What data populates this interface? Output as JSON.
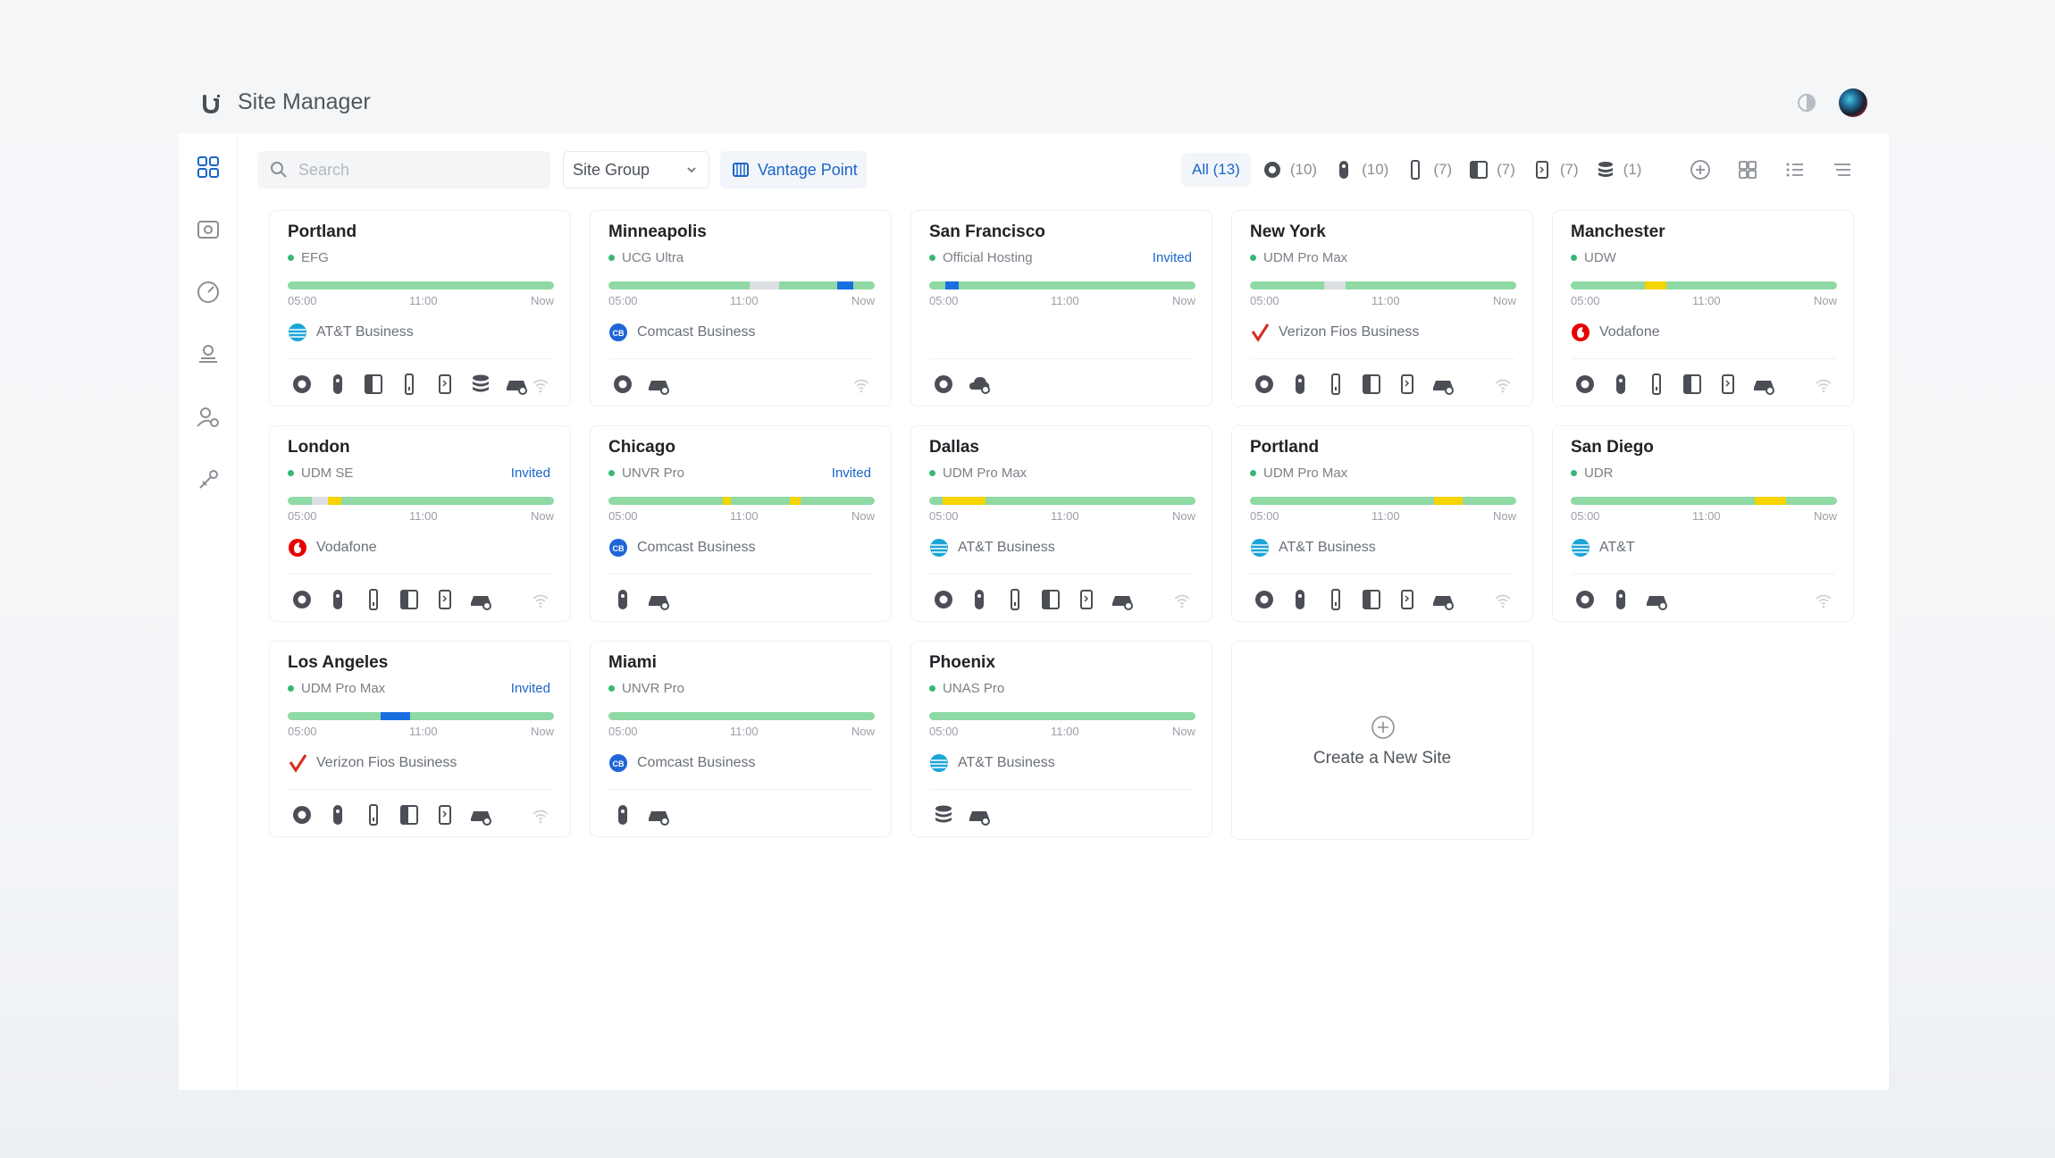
{
  "app": {
    "title": "Site Manager"
  },
  "toolbar": {
    "search_placeholder": "Search",
    "site_group_label": "Site Group",
    "vantage_point_label": "Vantage Point",
    "filters": [
      {
        "icon": "all",
        "label": "All (13)",
        "count": ""
      },
      {
        "icon": "console-icon",
        "label": "",
        "count": "(10)"
      },
      {
        "icon": "access-point-icon",
        "label": "",
        "count": "(10)"
      },
      {
        "icon": "tower-icon",
        "label": "",
        "count": "(7)"
      },
      {
        "icon": "switch-icon",
        "label": "",
        "count": "(7)"
      },
      {
        "icon": "doorbell-icon",
        "label": "",
        "count": "(7)"
      },
      {
        "icon": "storage-icon",
        "label": "",
        "count": "(1)"
      }
    ]
  },
  "colors": {
    "accent": "#1b66c9",
    "online": "#39b776",
    "bar_ok": "#8ed9a4",
    "bar_warn": "#f5d400",
    "bar_offline": "#dcdfe3",
    "bar_blue": "#1a6fe0"
  },
  "ticks": {
    "start": "05:00",
    "mid": "11:00",
    "end": "Now"
  },
  "sites": [
    {
      "name": "Portland",
      "device": "EFG",
      "invited": "",
      "isp": "AT&T Business",
      "isp_logo": "att",
      "segments": [],
      "devices": [
        "console",
        "access-point",
        "switch",
        "tower",
        "doorbell",
        "storage",
        "gateway"
      ],
      "wifi": true
    },
    {
      "name": "Minneapolis",
      "device": "UCG Ultra",
      "invited": "",
      "isp": "Comcast Business",
      "isp_logo": "comcast",
      "segments": [
        {
          "from": 0.53,
          "to": 0.64,
          "color": "offline"
        },
        {
          "from": 0.86,
          "to": 0.92,
          "color": "blue"
        }
      ],
      "devices": [
        "console",
        "gateway"
      ],
      "wifi": true
    },
    {
      "name": "San Francisco",
      "device": "Official Hosting",
      "invited": "Invited",
      "isp": "",
      "isp_logo": "",
      "segments": [
        {
          "from": 0.06,
          "to": 0.11,
          "color": "blue"
        }
      ],
      "devices": [
        "console",
        "cloud-gateway"
      ],
      "wifi": false
    },
    {
      "name": "New York",
      "device": "UDM Pro Max",
      "invited": "",
      "isp": "Verizon Fios Business",
      "isp_logo": "verizon",
      "segments": [
        {
          "from": 0.28,
          "to": 0.36,
          "color": "offline"
        }
      ],
      "devices": [
        "console",
        "access-point",
        "tower",
        "switch",
        "doorbell",
        "gateway"
      ],
      "wifi": true
    },
    {
      "name": "Manchester",
      "device": "UDW",
      "invited": "",
      "isp": "Vodafone",
      "isp_logo": "vodafone",
      "segments": [
        {
          "from": 0.28,
          "to": 0.36,
          "color": "warn"
        }
      ],
      "devices": [
        "console",
        "access-point",
        "tower",
        "switch",
        "doorbell",
        "gateway"
      ],
      "wifi": true
    },
    {
      "name": "London",
      "device": "UDM SE",
      "invited": "Invited",
      "isp": "Vodafone",
      "isp_logo": "vodafone",
      "segments": [
        {
          "from": 0.09,
          "to": 0.15,
          "color": "offline"
        },
        {
          "from": 0.15,
          "to": 0.2,
          "color": "warn"
        }
      ],
      "devices": [
        "console",
        "access-point",
        "tower",
        "switch",
        "doorbell",
        "gateway"
      ],
      "wifi": true
    },
    {
      "name": "Chicago",
      "device": "UNVR Pro",
      "invited": "Invited",
      "isp": "Comcast Business",
      "isp_logo": "comcast",
      "segments": [
        {
          "from": 0.43,
          "to": 0.46,
          "color": "warn"
        },
        {
          "from": 0.68,
          "to": 0.72,
          "color": "warn"
        }
      ],
      "devices": [
        "access-point",
        "gateway"
      ],
      "wifi": false
    },
    {
      "name": "Dallas",
      "device": "UDM Pro Max",
      "invited": "",
      "isp": "AT&T Business",
      "isp_logo": "att",
      "segments": [
        {
          "from": 0.05,
          "to": 0.21,
          "color": "warn"
        }
      ],
      "devices": [
        "console",
        "access-point",
        "tower",
        "switch",
        "doorbell",
        "gateway"
      ],
      "wifi": true
    },
    {
      "name": "Portland",
      "device": "UDM Pro Max",
      "invited": "",
      "isp": "AT&T Business",
      "isp_logo": "att",
      "segments": [
        {
          "from": 0.69,
          "to": 0.8,
          "color": "warn"
        }
      ],
      "devices": [
        "console",
        "access-point",
        "tower",
        "switch",
        "doorbell",
        "gateway"
      ],
      "wifi": true
    },
    {
      "name": "San Diego",
      "device": "UDR",
      "invited": "",
      "isp": "AT&T",
      "isp_logo": "att",
      "segments": [
        {
          "from": 0.69,
          "to": 0.81,
          "color": "warn"
        }
      ],
      "devices": [
        "console",
        "access-point",
        "gateway"
      ],
      "wifi": true
    },
    {
      "name": "Los Angeles",
      "device": "UDM Pro Max",
      "invited": "Invited",
      "isp": "Verizon Fios Business",
      "isp_logo": "verizon",
      "segments": [
        {
          "from": 0.35,
          "to": 0.46,
          "color": "blue"
        }
      ],
      "devices": [
        "console",
        "access-point",
        "tower",
        "switch",
        "doorbell",
        "gateway"
      ],
      "wifi": true
    },
    {
      "name": "Miami",
      "device": "UNVR Pro",
      "invited": "",
      "isp": "Comcast Business",
      "isp_logo": "comcast",
      "segments": [],
      "devices": [
        "access-point",
        "gateway"
      ],
      "wifi": false
    },
    {
      "name": "Phoenix",
      "device": "UNAS Pro",
      "invited": "",
      "isp": "AT&T Business",
      "isp_logo": "att",
      "segments": [],
      "devices": [
        "storage",
        "gateway"
      ],
      "wifi": false
    }
  ],
  "new_site": {
    "label": "Create a New Site"
  }
}
